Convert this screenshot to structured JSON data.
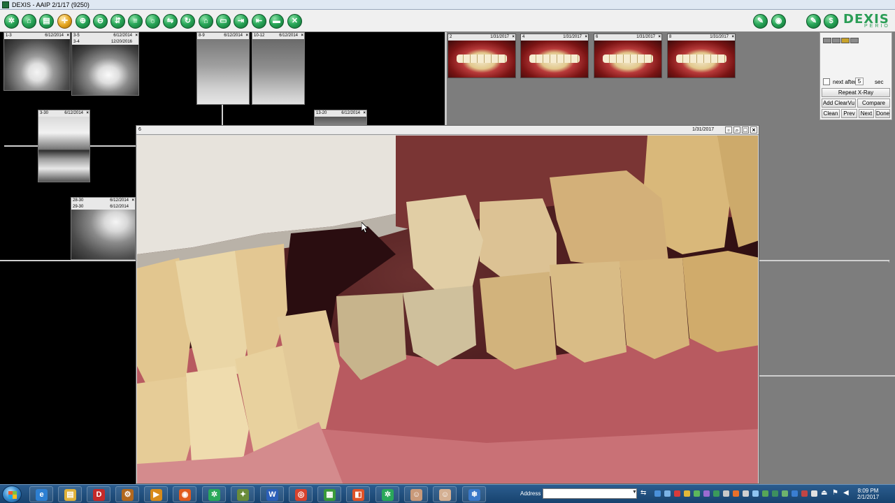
{
  "window": {
    "title": "DEXIS - AAIP 2/1/17 (9250)"
  },
  "toolbar": {
    "buttons": [
      {
        "name": "acquire-icon",
        "glyph": "✲"
      },
      {
        "name": "tooth-icon",
        "glyph": "⌂"
      },
      {
        "name": "print-icon",
        "glyph": "▤"
      },
      {
        "name": "crosshair-icon",
        "glyph": "✛"
      },
      {
        "name": "zoom-in-icon",
        "glyph": "⊕"
      },
      {
        "name": "zoom-out-icon",
        "glyph": "⊖"
      },
      {
        "name": "measure-icon",
        "glyph": "⇵"
      },
      {
        "name": "notes-icon",
        "glyph": "≡"
      },
      {
        "name": "brightness-icon",
        "glyph": "☼"
      },
      {
        "name": "mirror-icon",
        "glyph": "⇋"
      },
      {
        "name": "rotate-icon",
        "glyph": "↻"
      },
      {
        "name": "home-icon",
        "glyph": "⌂"
      },
      {
        "name": "open-folder-icon",
        "glyph": "▭"
      },
      {
        "name": "import-icon",
        "glyph": "⇥"
      },
      {
        "name": "export-icon",
        "glyph": "⇤"
      },
      {
        "name": "save-icon",
        "glyph": "▬"
      },
      {
        "name": "close-icon",
        "glyph": "✕"
      }
    ],
    "right_buttons": [
      {
        "name": "edit-icon",
        "glyph": "✎"
      },
      {
        "name": "camera-icon",
        "glyph": "◉"
      },
      {
        "name": "pen-icon",
        "glyph": "✎"
      },
      {
        "name": "dollar-icon",
        "glyph": "$"
      }
    ],
    "logo_word": "DEXIS",
    "logo_sub": "PERIO"
  },
  "xray_tiles": [
    {
      "label": "1-3",
      "label2": "",
      "date": "6/12/2014",
      "date2": ""
    },
    {
      "label": "3-5",
      "label2": "3-4",
      "date": "6/12/2014",
      "date2": "12/20/2016"
    },
    {
      "label": "8-9",
      "label2": "",
      "date": "6/12/2014",
      "date2": ""
    },
    {
      "label": "10-12",
      "label2": "",
      "date": "6/12/2014",
      "date2": ""
    },
    {
      "label": "3-30",
      "label2": "",
      "date": "6/12/2014",
      "date2": ""
    },
    {
      "label": "13-20",
      "label2": "",
      "date": "6/12/2014",
      "date2": ""
    },
    {
      "label": "28-30",
      "label2": "29-30",
      "date": "6/12/2014",
      "date2": "6/12/2014"
    }
  ],
  "photos": [
    {
      "num": "2",
      "date": "1/31/2017"
    },
    {
      "num": "4",
      "date": "1/31/2017"
    },
    {
      "num": "6",
      "date": "1/31/2017"
    },
    {
      "num": "8",
      "date": "1/31/2017"
    }
  ],
  "control_panel": {
    "next_after_label": "next after",
    "next_after_value": "5",
    "sec_label": "sec",
    "repeat_xray": "Repeat X-Ray",
    "add_clearvu": "Add ClearVu",
    "compare": "Compare",
    "clean": "Clean",
    "prev": "Prev",
    "next": "Next",
    "done": "Done"
  },
  "viewer": {
    "num": "6",
    "date": "1/31/2017"
  },
  "taskbar": {
    "address_label": "Address",
    "clock_time": "8:09 PM",
    "clock_date": "2/1/2017",
    "apps": [
      {
        "name": "ie-icon",
        "glyph": "e",
        "color": "#2d7fd2"
      },
      {
        "name": "explorer-icon",
        "glyph": "▤",
        "color": "#e0b23a"
      },
      {
        "name": "app-icon",
        "glyph": "D",
        "color": "#c42a2a"
      },
      {
        "name": "tools-icon",
        "glyph": "⚙",
        "color": "#b2681d"
      },
      {
        "name": "media-icon",
        "glyph": "▶",
        "color": "#d88b1a"
      },
      {
        "name": "firefox-icon",
        "glyph": "◉",
        "color": "#e05a1e"
      },
      {
        "name": "dexis-icon",
        "glyph": "✲",
        "color": "#2aa85a"
      },
      {
        "name": "utility-icon",
        "glyph": "✦",
        "color": "#6a8c3a"
      },
      {
        "name": "word-icon",
        "glyph": "W",
        "color": "#2b5fb8"
      },
      {
        "name": "chrome-icon",
        "glyph": "◎",
        "color": "#d9432e"
      },
      {
        "name": "tiles-icon",
        "glyph": "▦",
        "color": "#3a9a3a"
      },
      {
        "name": "office-icon",
        "glyph": "◧",
        "color": "#e0532a"
      },
      {
        "name": "dexis2-icon",
        "glyph": "✲",
        "color": "#2aa85a"
      },
      {
        "name": "person-icon",
        "glyph": "☺",
        "color": "#c99a7a"
      },
      {
        "name": "person2-icon",
        "glyph": "☺",
        "color": "#d4b093"
      },
      {
        "name": "snowflake-icon",
        "glyph": "❄",
        "color": "#3a78c8"
      }
    ]
  }
}
